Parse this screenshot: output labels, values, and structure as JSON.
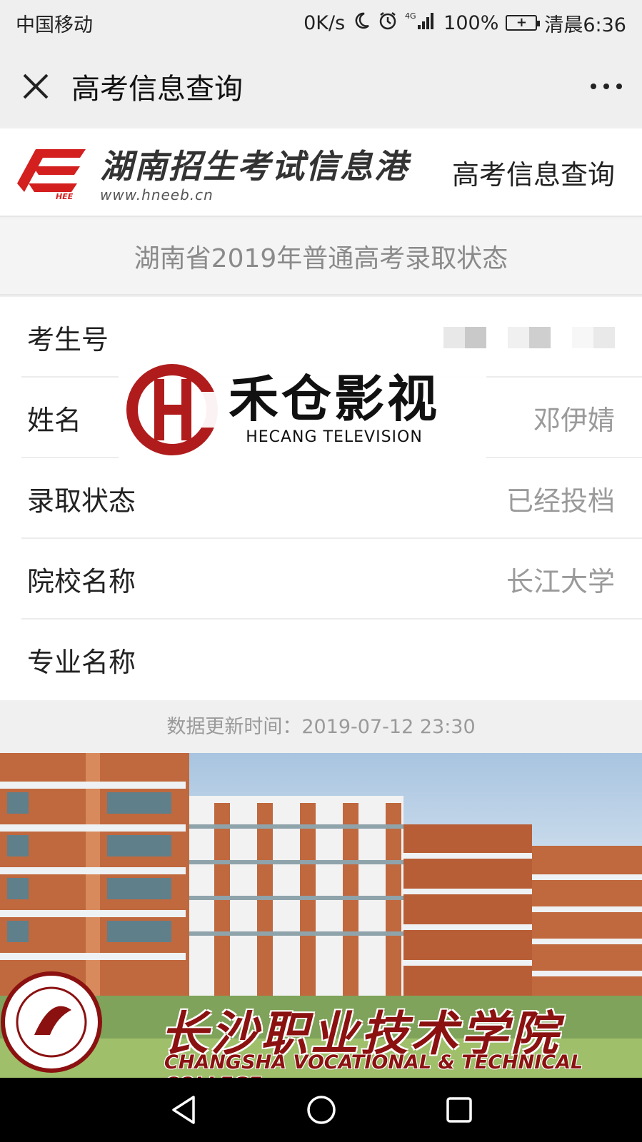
{
  "status_bar": {
    "carrier": "中国移动",
    "speed": "0K/s",
    "network": "4G",
    "battery": "100%",
    "time": "清晨6:36"
  },
  "topbar": {
    "title": "高考信息查询"
  },
  "site_header": {
    "logo_mark": "HEE",
    "site_name": "湖南招生考试信息港",
    "site_url": "www.hneeb.cn",
    "page_link": "高考信息查询"
  },
  "subtitle": "湖南省2019年普通高考录取状态",
  "fields": [
    {
      "label": "考生号",
      "value": ""
    },
    {
      "label": "姓名",
      "value": "邓伊婧"
    },
    {
      "label": "录取状态",
      "value": "已经投档"
    },
    {
      "label": "院校名称",
      "value": "长江大学"
    },
    {
      "label": "专业名称",
      "value": ""
    }
  ],
  "updated": "数据更新时间：2019-07-12 23:30",
  "watermark": {
    "cn": "禾仓影视",
    "en": "HECANG TELEVISION"
  },
  "banner": {
    "caption": "长沙职业技术学院",
    "caption_en": "CHANGSHA VOCATIONAL & TECHNICAL COLLEGE"
  },
  "colors": {
    "brand_red": "#d41f1f",
    "watermark_red": "#b01c1c",
    "banner_text": "#8b1111"
  }
}
